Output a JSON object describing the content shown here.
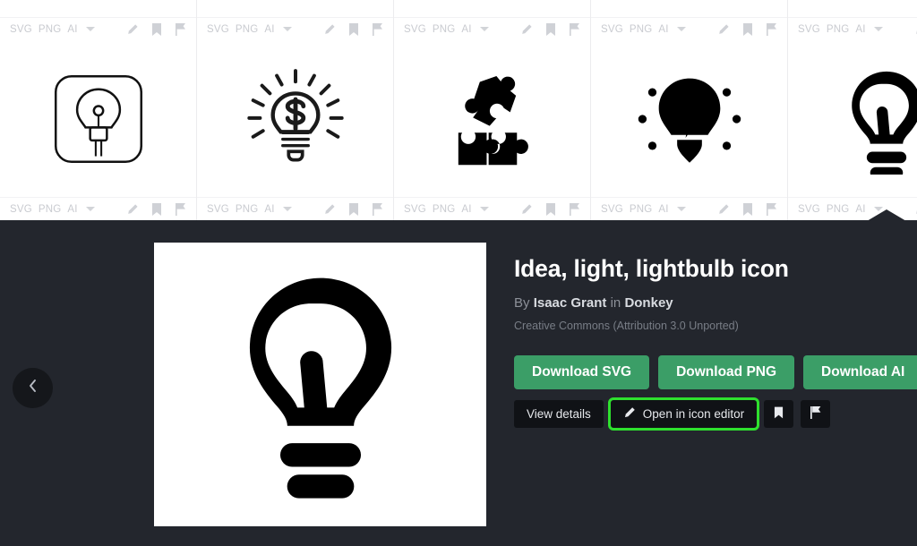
{
  "grid": {
    "formats": [
      "SVG",
      "PNG",
      "AI"
    ],
    "dropdown_icon": "chevron-down-icon",
    "row_actions": [
      "edit-pencil-icon",
      "bookmark-icon",
      "flag-icon"
    ],
    "partial_row_cells": [
      {
        "icon_name": "lightbulb-outline-rounded-square-icon"
      },
      {
        "icon_name": "lightbulb-dollar-sketch-icon"
      },
      {
        "icon_name": "puzzle-pieces-icon"
      },
      {
        "icon_name": "lightbulb-bolt-rays-icon"
      },
      {
        "icon_name": "lightbulb-solid-icon"
      }
    ],
    "cells": [
      {
        "icon_name": "lightbulb-outline-rounded-square-icon"
      },
      {
        "icon_name": "lightbulb-dollar-sketch-icon"
      },
      {
        "icon_name": "puzzle-pieces-icon"
      },
      {
        "icon_name": "lightbulb-bolt-rays-icon"
      },
      {
        "icon_name": "lightbulb-solid-icon"
      }
    ]
  },
  "drawer": {
    "back_icon": "chevron-left-icon",
    "preview_icon_name": "lightbulb-solid-icon",
    "title": "Idea, light, lightbulb icon",
    "author_prefix": "By",
    "author_name": "Isaac Grant",
    "author_mid": "in",
    "collection_name": "Donkey",
    "license": "Creative Commons (Attribution 3.0 Unported)",
    "download_buttons": [
      {
        "label": "Download SVG"
      },
      {
        "label": "Download PNG"
      },
      {
        "label": "Download AI"
      }
    ],
    "actions": {
      "view_details": "View details",
      "open_editor": "Open in icon editor",
      "open_editor_icon": "edit-pencil-icon",
      "bookmark_icon": "bookmark-icon",
      "flag_icon": "flag-icon"
    }
  },
  "colors": {
    "drawer_bg": "#23262d",
    "download_green": "#3b9e67",
    "highlight_green": "#2ee02e",
    "action_bg": "#101216"
  }
}
